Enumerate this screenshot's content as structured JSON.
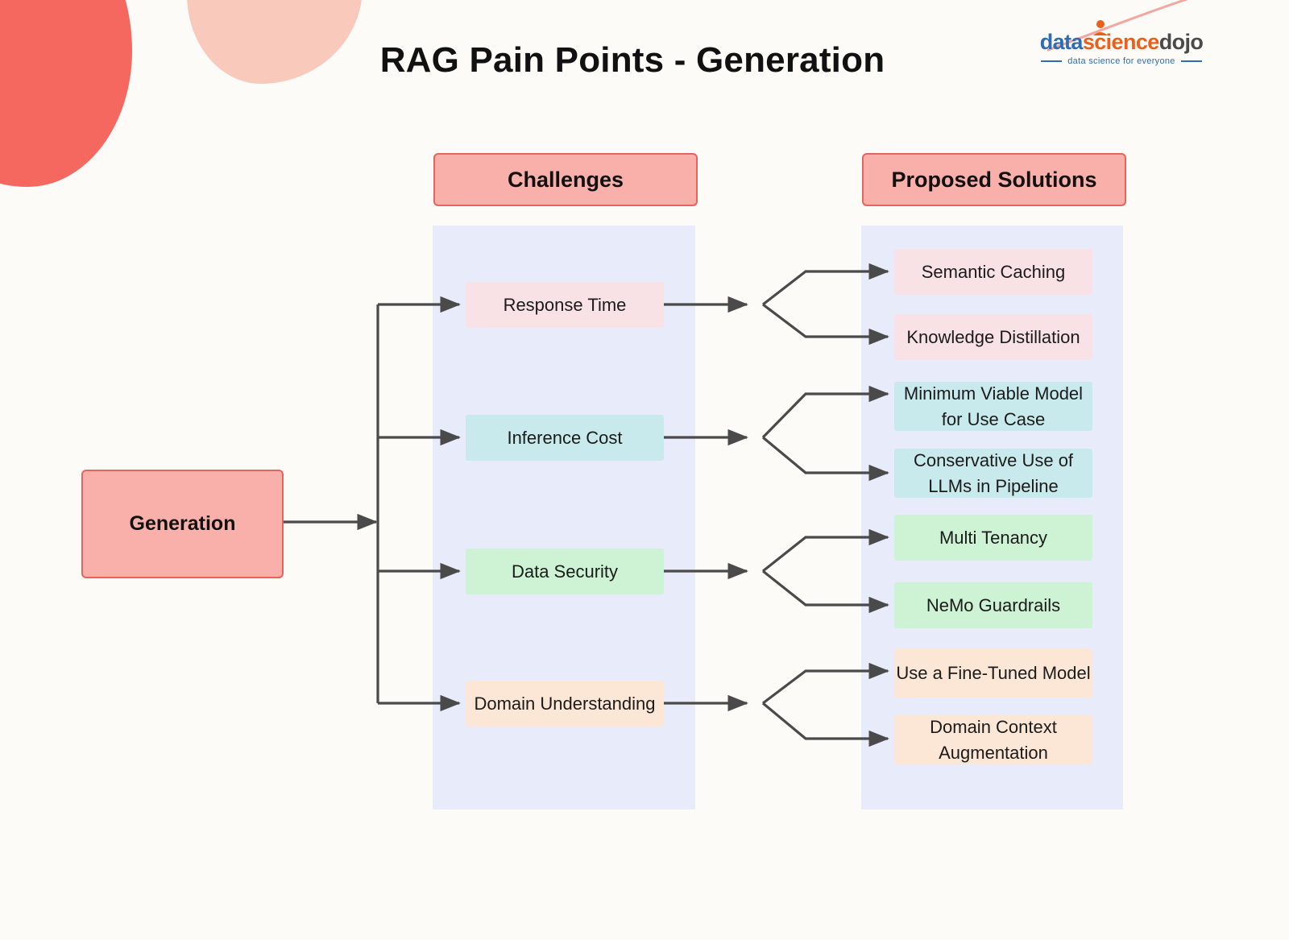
{
  "page": {
    "title": "RAG Pain Points - Generation",
    "background_color": "#FCFBF7"
  },
  "logo": {
    "part1": "data",
    "part2": "science",
    "part3": "dojo",
    "tagline": "data science for everyone",
    "color_part1": "#2E6DB4",
    "color_part2": "#E8601C",
    "color_part3": "#4A4A4A"
  },
  "columns": {
    "challenges_header": "Challenges",
    "solutions_header": "Proposed Solutions",
    "header_fill": "#F9AFAA",
    "header_border": "#E8635C",
    "band_fill": "#E8EBFA"
  },
  "root": {
    "label": "Generation",
    "fill": "#F9AFAA",
    "border": "#E8635C"
  },
  "challenges": [
    {
      "label": "Response Time",
      "fill": "#F8E2E6"
    },
    {
      "label": "Inference Cost",
      "fill": "#C8EAEC"
    },
    {
      "label": "Data Security",
      "fill": "#CDF3D4"
    },
    {
      "label": "Domain Understanding",
      "fill": "#FCE6D5"
    }
  ],
  "solutions": [
    {
      "label": "Semantic Caching",
      "fill": "#F8E2E6",
      "parent": "Response Time"
    },
    {
      "label": "Knowledge Distillation",
      "fill": "#F8E2E6",
      "parent": "Response Time"
    },
    {
      "label": "Minimum Viable Model for Use Case",
      "fill": "#C8EAEC",
      "parent": "Inference Cost"
    },
    {
      "label": "Conservative Use of LLMs in Pipeline",
      "fill": "#C8EAEC",
      "parent": "Inference Cost"
    },
    {
      "label": "Multi Tenancy",
      "fill": "#CDF3D4",
      "parent": "Data Security"
    },
    {
      "label": "NeMo Guardrails",
      "fill": "#CDF3D4",
      "parent": "Data Security"
    },
    {
      "label": "Use a Fine-Tuned Model",
      "fill": "#FCE6D5",
      "parent": "Domain Understanding"
    },
    {
      "label": "Domain Context Augmentation",
      "fill": "#FCE6D5",
      "parent": "Domain Understanding"
    }
  ],
  "decor": {
    "blob_coral": "#F4685F",
    "blob_pink": "#F9C9BC",
    "curve_line": "#F2A7A0"
  },
  "connectors": {
    "stroke": "#4A4A4A"
  }
}
